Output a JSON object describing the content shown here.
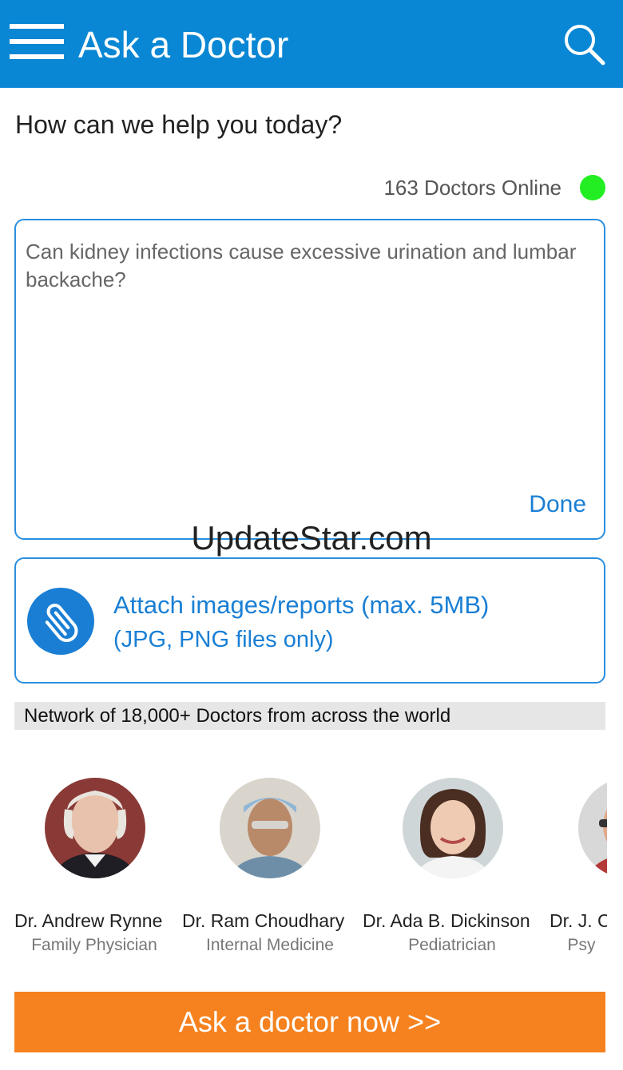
{
  "appbar": {
    "title": "Ask a Doctor",
    "color": "#0a87d4",
    "menu_icon": "hamburger-menu-icon",
    "search_icon": "search-icon"
  },
  "main": {
    "heading": "How can we help you today?",
    "online_status": "163 Doctors Online",
    "online_color": "#22ee22",
    "question": {
      "value": "Can kidney infections cause excessive urination and lumbar backache?",
      "done_label": "Done"
    },
    "watermark": "UpdateStar.com",
    "attach": {
      "icon": "paperclip-icon",
      "line1": "Attach images/reports (max. 5MB)",
      "line2": "(JPG, PNG files only)"
    },
    "network_banner": "Network of 18,000+ Doctors from across the world",
    "doctors": [
      {
        "name": "Dr. Andrew Rynne",
        "specialty": "Family Physician"
      },
      {
        "name": "Dr. Ram Choudhary",
        "specialty": "Internal Medicine"
      },
      {
        "name": "Dr. Ada B. Dickinson",
        "specialty": "Pediatrician"
      },
      {
        "name": "Dr. J. C",
        "specialty": "Psy"
      }
    ]
  },
  "cta": {
    "label": "Ask a doctor now >>",
    "color": "#f5821f"
  }
}
